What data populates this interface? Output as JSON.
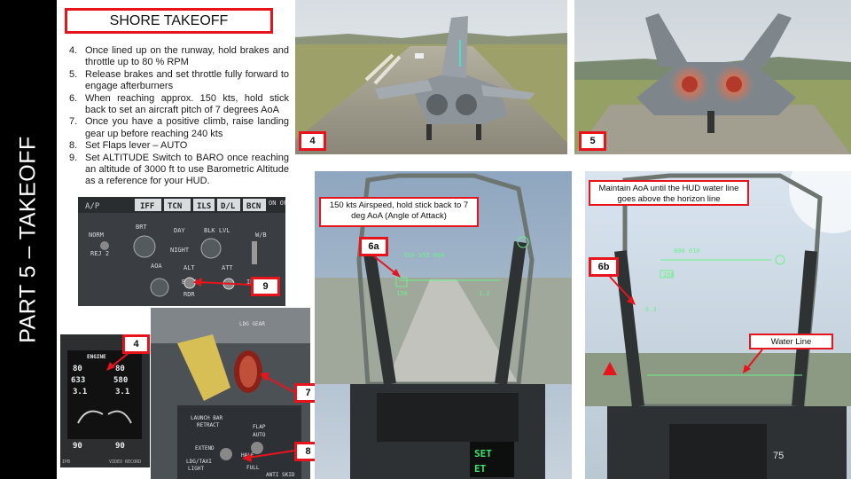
{
  "side_title": "PART 5 – TAKEOFF",
  "section_title": "SHORE TAKEOFF",
  "steps": [
    {
      "num": "4.",
      "text": "Once lined up on the runway, hold brakes and throttle up to 80 % RPM"
    },
    {
      "num": "5.",
      "text": "Release brakes and set throttle fully forward to engage afterburners"
    },
    {
      "num": "6.",
      "text": "When reaching approx. 150 kts, hold stick back to set an aircraft pitch of 7 degrees AoA"
    },
    {
      "num": "7.",
      "text": "Once you have a positive climb, raise landing gear up before reaching 240 kts"
    },
    {
      "num": "8.",
      "text": "Set Flaps lever – AUTO"
    },
    {
      "num": "9.",
      "text": "Set ALTITUDE Switch to BARO once reaching an altitude of 3000 ft to use Barometric Altitude as a reference for your HUD."
    }
  ],
  "tags": {
    "photo4": "4",
    "photo5": "5",
    "panel9": "9",
    "engine4": "4",
    "gear7": "7",
    "flap8": "8",
    "hud6a": "6a",
    "hud6b": "6b"
  },
  "callouts": {
    "airspeed_note": "150 kts Airspeed, hold stick back to 7 deg AoA (Angle of Attack)",
    "aoa_note": "Maintain AoA until the HUD water line goes above the horizon line",
    "water_line": "Water Line"
  },
  "panel_labels": {
    "ap": "A/P",
    "iff": "IFF",
    "tcn": "TCN",
    "ils": "ILS",
    "dl": "D/L",
    "bcn": "BCN",
    "onoff": "ON OFF",
    "brt": "BRT",
    "day": "DAY",
    "night": "NIGHT",
    "blk_lvl": "BLK LVL",
    "wb": "W/B",
    "norm": "NORM",
    "rej": "REJ 2",
    "aoa": "AOA",
    "alt": "ALT",
    "att": "ATT",
    "baro": "BARO",
    "rdr": "RDR",
    "ins": "INS",
    "auto": "AUTO",
    "stby": "STBY",
    "off": "OFF",
    "hdg": "HDG"
  },
  "engine_display": {
    "header": "ENGINE",
    "rpm": [
      "80",
      "80"
    ],
    "egt": [
      "633",
      "580"
    ],
    "ff": [
      "3.1",
      "3.1"
    ],
    "noz": [
      "90",
      "90"
    ],
    "ipb": "IPB",
    "video_record": "VIDEO RECORD"
  },
  "gear_panel_labels": {
    "ldg_gear": "LDG GEAR",
    "launch_bar": "LAUNCH BAR",
    "retract": "RETRACT",
    "extend": "EXTEND",
    "flap": "FLAP",
    "auto": "AUTO",
    "half": "HALF",
    "full": "FULL",
    "ldg_taxi": "LDG/TAXI",
    "light": "LIGHT",
    "anti_skid": "ANTI SKID"
  },
  "hud_6a": {
    "heading_marks": "350 355 000",
    "speed": "150",
    "altitude": "1.2"
  },
  "hud_6b": {
    "heading_marks": "000 010",
    "speed": "200",
    "aoa": "6.3"
  },
  "ufc_display": [
    "SET",
    "ET"
  ],
  "page_number": "75",
  "colors": {
    "accent_red": "#e8141c",
    "hud_green": "#6cf08a",
    "band": "#000000"
  }
}
